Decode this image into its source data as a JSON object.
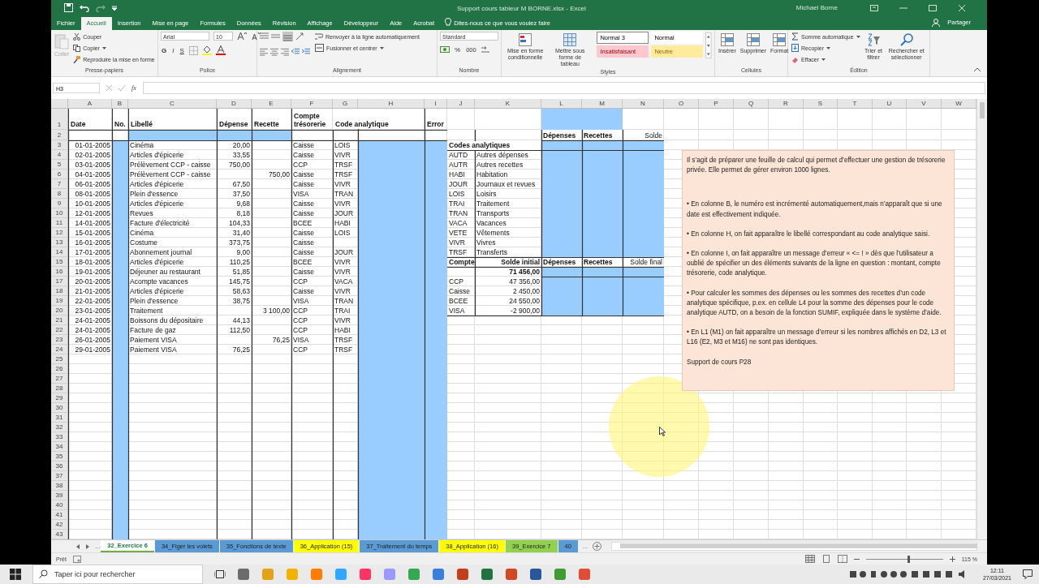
{
  "window": {
    "title": "Support cours tableur M BORNE.xlsx  -  Excel",
    "user": "Michael Borne"
  },
  "ribbon_tabs": [
    {
      "label": "Fichier",
      "selected": false
    },
    {
      "label": "Accueil",
      "selected": true
    },
    {
      "label": "Insertion",
      "selected": false
    },
    {
      "label": "Mise en page",
      "selected": false
    },
    {
      "label": "Formules",
      "selected": false
    },
    {
      "label": "Données",
      "selected": false
    },
    {
      "label": "Révision",
      "selected": false
    },
    {
      "label": "Affichage",
      "selected": false
    },
    {
      "label": "Développeur",
      "selected": false
    },
    {
      "label": "Aide",
      "selected": false
    },
    {
      "label": "Acrobat",
      "selected": false
    }
  ],
  "tell_me": "Dites-nous ce que vous voulez faire",
  "share": "Partager",
  "ribbon": {
    "clipboard": {
      "label": "Presse-papiers",
      "paste": {
        "label": "Coller",
        "disabled": true
      },
      "cut": "Couper",
      "copy": "Copier",
      "painter": "Reproduire la mise en forme"
    },
    "font": {
      "label": "Police",
      "name": "Arial",
      "size": "10",
      "bold": "G",
      "italic": "I",
      "underline": "S"
    },
    "alignment": {
      "label": "Alignement",
      "wrap": "Renvoyer à la ligne automatiquement",
      "merge": "Fusionner et centrer"
    },
    "number": {
      "label": "Nombre",
      "format": "Standard",
      "percent": "%",
      "thousands": "000"
    },
    "styles": {
      "label": "Styles",
      "conditional": "Mise en forme conditionnelle",
      "as_table": "Mettre sous forme de tableau",
      "gallery": [
        {
          "label": "Normal 3",
          "kind": "framed"
        },
        {
          "label": "Normal",
          "kind": "plain"
        },
        {
          "label": "Insatisfaisant",
          "kind": "bad"
        },
        {
          "label": "Neutre",
          "kind": "neutral"
        }
      ]
    },
    "cells": {
      "label": "Cellules",
      "buttons": [
        "Insérer",
        "Supprimer",
        "Format"
      ]
    },
    "editing": {
      "label": "Édition",
      "autosum": "Somme automatique",
      "fill": "Recopier",
      "clear": "Effacer",
      "sort": "Trier et filtrer",
      "find": "Rechercher et sélectionner"
    }
  },
  "formula_bar": {
    "name_box": "H3",
    "fx": "fx"
  },
  "sheet": {
    "column_headers": [
      "A",
      "B",
      "C",
      "D",
      "E",
      "F",
      "G",
      "H",
      "I",
      "J",
      "K",
      "L",
      "M",
      "N",
      "O",
      "P",
      "Q",
      "R",
      "S",
      "T",
      "U",
      "V",
      "W"
    ],
    "row_headers": [
      "1",
      "2",
      "3",
      "4",
      "5",
      "6",
      "7",
      "8",
      "9",
      "10",
      "11",
      "12",
      "13",
      "14",
      "15",
      "16",
      "17",
      "18",
      "19",
      "20",
      "21",
      "22",
      "23",
      "24",
      "25",
      "26",
      "27",
      "28",
      "29",
      "30",
      "31",
      "32",
      "33",
      "34",
      "35",
      "36",
      "37",
      "38",
      "39",
      "40",
      "41",
      "42",
      "43"
    ],
    "ledger": {
      "headers": [
        "Date",
        "No.",
        "Libellé",
        "Dépense",
        "Recette",
        "Compte trésorerie",
        "Code analytique",
        "Error"
      ],
      "rows": [
        {
          "date": "01-01-2005",
          "label": "Cinéma",
          "expense": "20,00",
          "account": "Caisse",
          "code": "LOIS"
        },
        {
          "date": "02-01-2005",
          "label": "Articles d'épicerie",
          "expense": "33,55",
          "account": "Caisse",
          "code": "VIVR"
        },
        {
          "date": "03-01-2005",
          "label": "Prélèvement CCP - caisse",
          "expense": "750,00",
          "account": "CCP",
          "code": "TRSF"
        },
        {
          "date": "04-01-2005",
          "label": "Prélèvement CCP - caisse",
          "income": "750,00",
          "account": "Caisse",
          "code": "TRSF"
        },
        {
          "date": "06-01-2005",
          "label": "Articles d'épicerie",
          "expense": "67,50",
          "account": "Caisse",
          "code": "VIVR"
        },
        {
          "date": "08-01-2005",
          "label": "Plein d'essence",
          "expense": "37,50",
          "account": "VISA",
          "code": "TRAN"
        },
        {
          "date": "10-01-2005",
          "label": "Articles d'épicerie",
          "expense": "9,68",
          "account": "Caisse",
          "code": "VIVR"
        },
        {
          "date": "12-01-2005",
          "label": "Revues",
          "expense": "8,18",
          "account": "Caisse",
          "code": "JOUR"
        },
        {
          "date": "14-01-2005",
          "label": "Facture d'électricité",
          "expense": "104,33",
          "account": "BCEE",
          "code": "HABI"
        },
        {
          "date": "15-01-2005",
          "label": "Cinéma",
          "expense": "31,40",
          "account": "Caisse",
          "code": "LOIS"
        },
        {
          "date": "16-01-2005",
          "label": "Costume",
          "expense": "373,75",
          "account": "Caisse"
        },
        {
          "date": "17-01-2005",
          "label": "Abonnement journal",
          "expense": "9,00",
          "account": "Caisse",
          "code": "JOUR"
        },
        {
          "date": "18-01-2005",
          "label": "Articles d'épicerie",
          "expense": "110,25",
          "account": "BCEE",
          "code": "VIVR"
        },
        {
          "date": "19-01-2005",
          "label": "Déjeuner au restaurant",
          "expense": "51,85",
          "account": "Caisse",
          "code": "VIVR"
        },
        {
          "date": "20-01-2005",
          "label": "Acompte vacances",
          "expense": "145,75",
          "account": "CCP",
          "code": "VACA"
        },
        {
          "date": "21-01-2005",
          "label": "Articles d'épicerie",
          "expense": "58,63",
          "account": "Caisse",
          "code": "VIVR"
        },
        {
          "date": "22-01-2005",
          "label": "Plein d'essence",
          "expense": "38,75",
          "account": "VISA",
          "code": "TRAN"
        },
        {
          "date": "23-01-2005",
          "label": "Traitement",
          "income": "3 100,00",
          "account": "CCP",
          "code": "TRAI"
        },
        {
          "date": "24-01-2005",
          "label": "Boissons du dépositaire",
          "expense": "44,13",
          "account": "CCP",
          "code": "VIVR"
        },
        {
          "date": "24-01-2005",
          "label": "Facture de gaz",
          "expense": "112,50",
          "account": "CCP",
          "code": "HABI"
        },
        {
          "date": "26-01-2005",
          "label": "Paiement VISA",
          "income": "76,25",
          "account": "VISA",
          "code": "TRSF"
        },
        {
          "date": "29-01-2005",
          "label": "Paiement VISA",
          "expense": "76,25",
          "account": "CCP",
          "code": "TRSF"
        }
      ]
    },
    "summary_headers": [
      {
        "text": "Dépenses",
        "bold": true
      },
      {
        "text": "Recettes",
        "bold": true
      },
      {
        "text": "Solde",
        "bold": false
      }
    ],
    "codes": {
      "title": "Codes analytiques",
      "items": [
        {
          "code": "AUTD",
          "label": "Autres dépenses"
        },
        {
          "code": "AUTR",
          "label": "Autres recettes"
        },
        {
          "code": "HABI",
          "label": "Habitation"
        },
        {
          "code": "JOUR",
          "label": "Journaux et revues"
        },
        {
          "code": "LOIS",
          "label": "Loisirs"
        },
        {
          "code": "TRAI",
          "label": "Traitement"
        },
        {
          "code": "TRAN",
          "label": "Transports"
        },
        {
          "code": "VACA",
          "label": "Vacances"
        },
        {
          "code": "VETE",
          "label": "Vêtements"
        },
        {
          "code": "VIVR",
          "label": "Vivres"
        },
        {
          "code": "TRSF",
          "label": "Transferts"
        }
      ]
    },
    "accounts": {
      "headers": [
        {
          "text": "Compte",
          "bold": true
        },
        {
          "text": "Solde initial",
          "bold": true
        },
        {
          "text": "Dépenses",
          "bold": true
        },
        {
          "text": "Recettes",
          "bold": true
        },
        {
          "text": "Solde final",
          "bold": false
        }
      ],
      "total": "71 456,00",
      "rows": [
        {
          "name": "CCP",
          "balance": "47 356,00"
        },
        {
          "name": "Caisse",
          "balance": "2 450,00"
        },
        {
          "name": "BCEE",
          "balance": "24 550,00"
        },
        {
          "name": "VISA",
          "balance": "-2 900,00"
        }
      ]
    }
  },
  "note": {
    "paragraphs": [
      "Il s’agit de préparer une feuille de calcul qui permet d’effectuer une gestion de trésorerie privée. Elle permet de gérer environ 1000 lignes.",
      "• En colonne B, le numéro est incrémenté automatiquement,mais n’apparaît que si une date est effectivement indiquée.",
      "• En colonne H, on fait apparaître le libellé correspondant au code analytique saisi.",
      "• En colonne I, on fait apparaître un message d’erreur « <= ! » dès que l’utilisateur a oublié de spécifier un des éléments suivants de la ligne en question : montant, compte trésorerie, code analytique.",
      "• Pour calculer les sommes des dépenses ou les sommes des recettes d’un code analytique spécifique, p.ex. en cellule L4 pour la somme des dépenses pour le code analytique AUTD, on a besoin de la fonction SUMIF, expliquée dans le système d’aide.",
      "• En L1 (M1) on fait apparaître un message d’erreur si les nombres affichés en D2, L3 et L16 (E2, M3 et M16) ne sont pas identiques.",
      "Support de cours P28"
    ]
  },
  "sheet_tabs": {
    "more_left": "...",
    "more_right": "...",
    "tabs": [
      {
        "label": "32_Exercice 6",
        "selected": true,
        "color": "#70ad47"
      },
      {
        "label": "34_Figer les volets",
        "selected": false,
        "color": "#5b9bd5"
      },
      {
        "label": "35_Fonctions de texte",
        "selected": false,
        "color": "#5b9bd5"
      },
      {
        "label": "36_Application (15)",
        "selected": false,
        "color": "#ffff00"
      },
      {
        "label": "37_Traitement du temps",
        "selected": false,
        "color": "#5b9bd5"
      },
      {
        "label": "38_Application (16)",
        "selected": false,
        "color": "#ffff00"
      },
      {
        "label": "39_Exercice 7",
        "selected": false,
        "color": "#92d050"
      },
      {
        "label": "40",
        "selected": false,
        "color": "#5b9bd5"
      }
    ]
  },
  "status_bar": {
    "ready": "Prêt",
    "zoom": {
      "level": 0.55,
      "reading": "115 %"
    }
  },
  "taskbar": {
    "search_placeholder": "Taper ici pour rechercher",
    "time": "12:11",
    "date": "27/03/2021"
  }
}
